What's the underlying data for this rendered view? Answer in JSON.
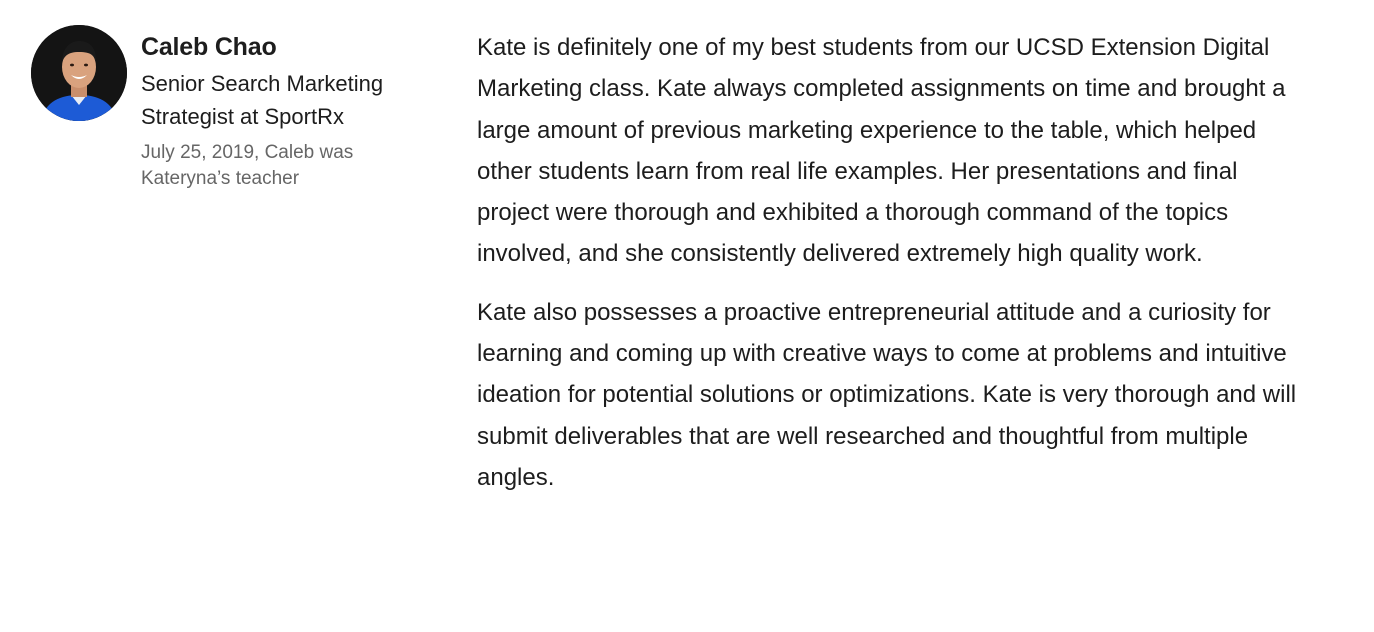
{
  "recommendation": {
    "author": {
      "avatar_icon": "person-photo-avatar",
      "name": "Caleb Chao",
      "headline": "Senior Search Marketing Strategist at SportRx",
      "meta": "July 25, 2019, Caleb was Kateryna’s teacher"
    },
    "paragraphs": [
      "Kate is definitely one of my best students from our UCSD Extension Digital Marketing class. Kate always completed assignments on time and brought a large amount of previous marketing experience to the table, which helped other students learn from real life examples. Her presentations and final project were thorough and exhibited a thorough command of the topics involved, and she consistently delivered extremely high quality work.",
      "Kate also possesses a proactive entrepreneurial attitude and a curiosity for learning and coming up with creative ways to come at problems and intuitive ideation for potential solutions or optimizations. Kate is very thorough and will submit deliverables that are well researched and thoughtful from multiple angles."
    ],
    "colors": {
      "text": "#1d1d1d",
      "meta_text": "#666666",
      "shirt_blue": "#1d5bd6",
      "background": "#ffffff"
    }
  }
}
